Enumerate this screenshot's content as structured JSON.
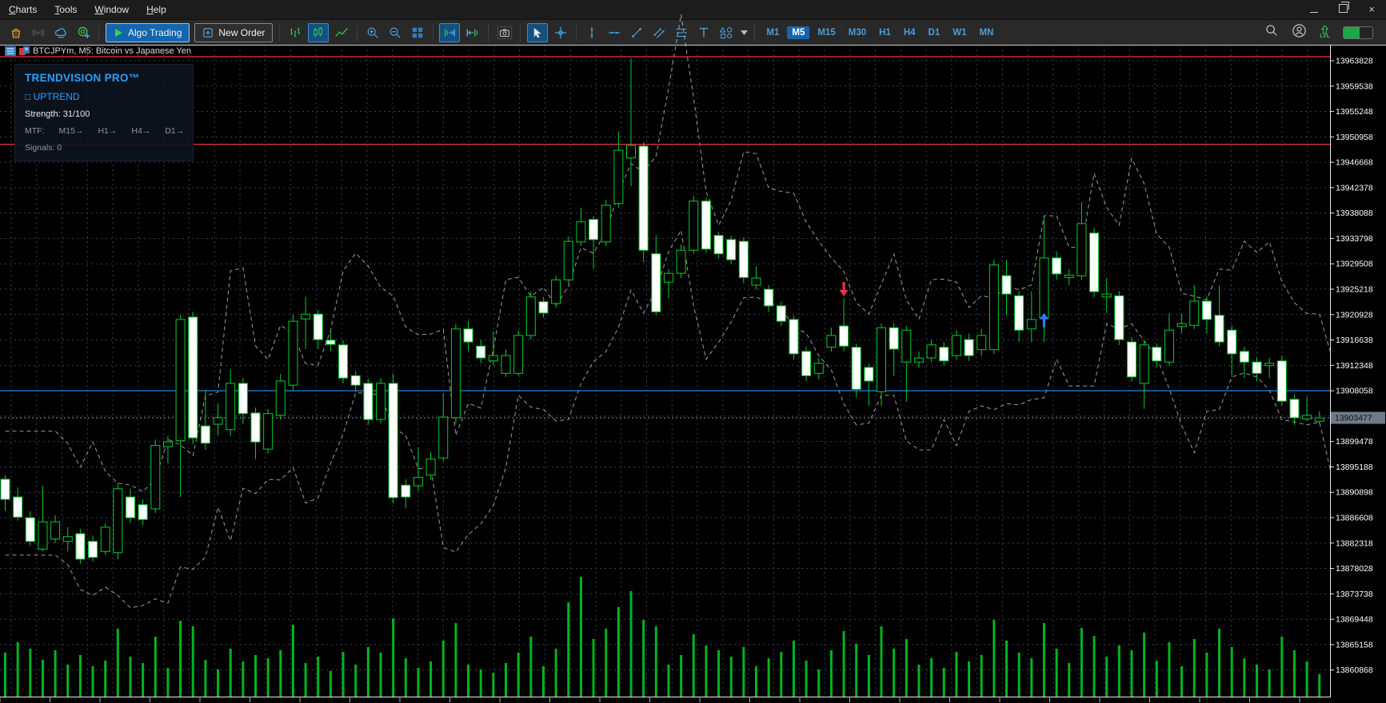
{
  "window": {
    "controls": [
      "minimize",
      "restore",
      "close"
    ]
  },
  "menubar": {
    "items": [
      "Charts",
      "Tools",
      "Window",
      "Help"
    ]
  },
  "toolbar": {
    "algo_trading_label": "Algo Trading",
    "new_order_label": "New Order",
    "icons": [
      "market-bag",
      "signals",
      "cloud",
      "community",
      "play",
      "new-order-doc",
      "bars-chart",
      "candles-chart",
      "line-chart",
      "zoom-in",
      "zoom-out",
      "tile-windows",
      "auto-scroll",
      "chart-shift",
      "screenshot",
      "cursor",
      "crosshair",
      "vertical-line",
      "horizontal-line",
      "trendline",
      "equidistant-channel",
      "fibonacci",
      "text-tool",
      "shapes",
      "dropdown-chevron",
      "search",
      "account",
      "levels-lvl",
      "connection-battery"
    ],
    "timeframes": [
      "M1",
      "M5",
      "M15",
      "M30",
      "H1",
      "H4",
      "D1",
      "W1",
      "MN"
    ],
    "active_timeframe": "M5"
  },
  "chart": {
    "symbol_title": "BTCJPYm, M5: Bitcoin vs Japanese Yen",
    "indicator_panel": {
      "title": "TRENDVISION PRO™",
      "trend": "□ UPTREND",
      "strength": "Strength: 31/100",
      "mtf_label": "MTF:",
      "mtf_items": [
        "M15→",
        "H1→",
        "H4→",
        "D1→"
      ],
      "signals": "Signals: 0"
    },
    "price_axis": {
      "labels": [
        13963828,
        13959538,
        13955248,
        13950958,
        13946668,
        13942378,
        13938088,
        13933798,
        13929508,
        13925218,
        13920928,
        13916638,
        13912348,
        13908058,
        13899478,
        13895188,
        13890898,
        13886608,
        13882318,
        13878028,
        13873738,
        13869448,
        13865158,
        13860868
      ],
      "grid_prices": [
        13963828,
        13959538,
        13955248,
        13950958,
        13946668,
        13942378,
        13938088,
        13933798,
        13929508,
        13925218,
        13920928,
        13916638,
        13912348,
        13908058,
        13903768,
        13899478,
        13895188,
        13890898,
        13886608,
        13882318,
        13878028,
        13873738,
        13869448,
        13865158,
        13860868
      ],
      "current_price": "13903477"
    },
    "levels": {
      "red_lines": [
        13964500,
        13949700
      ],
      "blue_line": 13908058,
      "current_price": 13903477
    },
    "arrows": [
      {
        "type": "sell-signal",
        "bar_index": 67,
        "price": 13924000,
        "color": "#e8344e"
      },
      {
        "type": "buy-signal",
        "bar_index": 83,
        "price": 13921200,
        "color": "#2e7bff"
      }
    ],
    "time_axis": {
      "labels": [],
      "tick_spacing_px": 62.5
    }
  },
  "chart_data": {
    "type": "candlestick",
    "symbol": "BTCJPYm",
    "timeframe": "M5",
    "price_grid_step": 4290,
    "visible_price_range": [
      13858000,
      13966000
    ],
    "bars": [
      [
        13893100,
        13893800,
        13887700,
        13889700
      ],
      [
        13890100,
        13891700,
        13886100,
        13886700
      ],
      [
        13886600,
        13887700,
        13881900,
        13882600
      ],
      [
        13881300,
        13892000,
        13880900,
        13885900
      ],
      [
        13883000,
        13887000,
        13882300,
        13885900
      ],
      [
        13882600,
        13885000,
        13880900,
        13883400
      ],
      [
        13883900,
        13884700,
        13878800,
        13879600
      ],
      [
        13882600,
        13883600,
        13879200,
        13879900
      ],
      [
        13880900,
        13885700,
        13880300,
        13885000
      ],
      [
        13880700,
        13892400,
        13879600,
        13891500
      ],
      [
        13890100,
        13891500,
        13885700,
        13886600
      ],
      [
        13888800,
        13889700,
        13885300,
        13886300
      ],
      [
        13888100,
        13899800,
        13887400,
        13898800
      ],
      [
        13898600,
        13900400,
        13895800,
        13899400
      ],
      [
        13899600,
        13920900,
        13890100,
        13920100
      ],
      [
        13920500,
        13921400,
        13899000,
        13900100
      ],
      [
        13902100,
        13908200,
        13898100,
        13899200
      ],
      [
        13902400,
        13905900,
        13900500,
        13903500
      ],
      [
        13901500,
        13911700,
        13900400,
        13909300
      ],
      [
        13909300,
        13910200,
        13902500,
        13904200
      ],
      [
        13904300,
        13905200,
        13896500,
        13899400
      ],
      [
        13898200,
        13905000,
        13897400,
        13904200
      ],
      [
        13903900,
        13910900,
        13903200,
        13909700
      ],
      [
        13909000,
        13920900,
        13908200,
        13919800
      ],
      [
        13920200,
        13923900,
        13915100,
        13921000
      ],
      [
        13921000,
        13921700,
        13915100,
        13916700
      ],
      [
        13916600,
        13918100,
        13914700,
        13915900
      ],
      [
        13915800,
        13916600,
        13909300,
        13910200
      ],
      [
        13910600,
        13911400,
        13907900,
        13909000
      ],
      [
        13909300,
        13910100,
        13902300,
        13903200
      ],
      [
        13903200,
        13910200,
        13902500,
        13909300
      ],
      [
        13909300,
        13911000,
        13889000,
        13890000
      ],
      [
        13892100,
        13893100,
        13888200,
        13890100
      ],
      [
        13892000,
        13898500,
        13891200,
        13893400
      ],
      [
        13893800,
        13897700,
        13893000,
        13896500
      ],
      [
        13896700,
        13907700,
        13896100,
        13903600
      ],
      [
        13903500,
        13919400,
        13902500,
        13918500
      ],
      [
        13918500,
        13919800,
        13914700,
        13916300
      ],
      [
        13915600,
        13916600,
        13912700,
        13913600
      ],
      [
        13913100,
        13918100,
        13912300,
        13914000
      ],
      [
        13911000,
        13915000,
        13910400,
        13914000
      ],
      [
        13911000,
        13918300,
        13910600,
        13917400
      ],
      [
        13917400,
        13924800,
        13916700,
        13923900
      ],
      [
        13923100,
        13923900,
        13920400,
        13921200
      ],
      [
        13922800,
        13927500,
        13922100,
        13926800
      ],
      [
        13926800,
        13934100,
        13926200,
        13933300
      ],
      [
        13933200,
        13939000,
        13932500,
        13936600
      ],
      [
        13937000,
        13937600,
        13928600,
        13933600
      ],
      [
        13933200,
        13940300,
        13932500,
        13939400
      ],
      [
        13939700,
        13951800,
        13939000,
        13948700
      ],
      [
        13947400,
        13964200,
        13942600,
        13949500
      ],
      [
        13949400,
        13950100,
        13929800,
        13931800
      ],
      [
        13931200,
        13934300,
        13920800,
        13921400
      ],
      [
        13926400,
        13928600,
        13923700,
        13927900
      ],
      [
        13927900,
        13932800,
        13927100,
        13931800
      ],
      [
        13931800,
        13941000,
        13931200,
        13940100
      ],
      [
        13940100,
        13940700,
        13931300,
        13932000
      ],
      [
        13934300,
        13934900,
        13930500,
        13931200
      ],
      [
        13933600,
        13934300,
        13929500,
        13930200
      ],
      [
        13933300,
        13934000,
        13926200,
        13927200
      ],
      [
        13925900,
        13929100,
        13925200,
        13927100
      ],
      [
        13925200,
        13925900,
        13921400,
        13922400
      ],
      [
        13922400,
        13923100,
        13919000,
        13919800
      ],
      [
        13920100,
        13920800,
        13913300,
        13914300
      ],
      [
        13914700,
        13915500,
        13909700,
        13910600
      ],
      [
        13911000,
        13913600,
        13910000,
        13912700
      ],
      [
        13915400,
        13918700,
        13914700,
        13917400
      ],
      [
        13919000,
        13923700,
        13914700,
        13915600
      ],
      [
        13915400,
        13916000,
        13907000,
        13908300
      ],
      [
        13912000,
        13912700,
        13905500,
        13909700
      ],
      [
        13907900,
        13919400,
        13905500,
        13918700
      ],
      [
        13918700,
        13919500,
        13910600,
        13915100
      ],
      [
        13912900,
        13919000,
        13906200,
        13918300
      ],
      [
        13912900,
        13914700,
        13912000,
        13913600
      ],
      [
        13913600,
        13916700,
        13912900,
        13915800
      ],
      [
        13915400,
        13916300,
        13912300,
        13913100
      ],
      [
        13914000,
        13918300,
        13913300,
        13917400
      ],
      [
        13916700,
        13917700,
        13913100,
        13914000
      ],
      [
        13915000,
        13918500,
        13914000,
        13917400
      ],
      [
        13915000,
        13930200,
        13914300,
        13929300
      ],
      [
        13927500,
        13930200,
        13920800,
        13924400
      ],
      [
        13924100,
        13924900,
        13916300,
        13918300
      ],
      [
        13918500,
        13924800,
        13916300,
        13920100
      ],
      [
        13920400,
        13937400,
        13916300,
        13930500
      ],
      [
        13930500,
        13931600,
        13926800,
        13927800
      ],
      [
        13927200,
        13928600,
        13925900,
        13927600
      ],
      [
        13927500,
        13939900,
        13926800,
        13936300
      ],
      [
        13934700,
        13935600,
        13923900,
        13924800
      ],
      [
        13923900,
        13927100,
        13921200,
        13924400
      ],
      [
        13924100,
        13924900,
        13915800,
        13916700
      ],
      [
        13916300,
        13917100,
        13909600,
        13910400
      ],
      [
        13909300,
        13916600,
        13905000,
        13915800
      ],
      [
        13915400,
        13916000,
        13912000,
        13913100
      ],
      [
        13912900,
        13921200,
        13912300,
        13918300
      ],
      [
        13918900,
        13921000,
        13917800,
        13919400
      ],
      [
        13919100,
        13925900,
        13918500,
        13923200
      ],
      [
        13923200,
        13924000,
        13917800,
        13920100
      ],
      [
        13920800,
        13925800,
        13915600,
        13916300
      ],
      [
        13918300,
        13919100,
        13910600,
        13914300
      ],
      [
        13914700,
        13915500,
        13910200,
        13912900
      ],
      [
        13912900,
        13913700,
        13909700,
        13911000
      ],
      [
        13912300,
        13913600,
        13910200,
        13912700
      ],
      [
        13913100,
        13914000,
        13905500,
        13906300
      ],
      [
        13906600,
        13907400,
        13902300,
        13903500
      ],
      [
        13903300,
        13907000,
        13902900,
        13903900
      ],
      [
        13902900,
        13904600,
        13902500,
        13903477
      ]
    ],
    "volume_relative": [
      55,
      68,
      60,
      46,
      58,
      40,
      52,
      38,
      45,
      85,
      50,
      42,
      75,
      36,
      95,
      88,
      46,
      34,
      60,
      44,
      52,
      48,
      58,
      90,
      42,
      50,
      32,
      56,
      40,
      62,
      55,
      98,
      48,
      36,
      44,
      70,
      92,
      40,
      34,
      30,
      42,
      55,
      75,
      38,
      60,
      118,
      150,
      72,
      85,
      112,
      132,
      96,
      88,
      40,
      52,
      78,
      64,
      58,
      50,
      62,
      38,
      48,
      56,
      70,
      45,
      34,
      58,
      82,
      66,
      52,
      88,
      60,
      72,
      40,
      48,
      36,
      56,
      44,
      52,
      96,
      70,
      55,
      48,
      92,
      60,
      42,
      86,
      76,
      50,
      64,
      58,
      80,
      45,
      68,
      38,
      72,
      55,
      85,
      62,
      48,
      40,
      34,
      75,
      58,
      44,
      28
    ]
  },
  "colors": {
    "background": "#000000",
    "candle_outline": "#00cd2c",
    "bull_fill": "#000000",
    "bear_fill": "#ffffff",
    "volume": "#00b41e",
    "grid": "#33424e",
    "envelope": "#ccd2d8",
    "blue_level": "#2086e0",
    "red_level": "#e8344e",
    "current_price_line": "#8b959e",
    "price_tag_bg": "#6e7b89",
    "price_tag_text": "#0a0e12",
    "axis_text": "#ffffff",
    "accent_blue": "#1565ad",
    "icon_blue": "#4a9fd8",
    "icon_green": "#2fc84e"
  }
}
